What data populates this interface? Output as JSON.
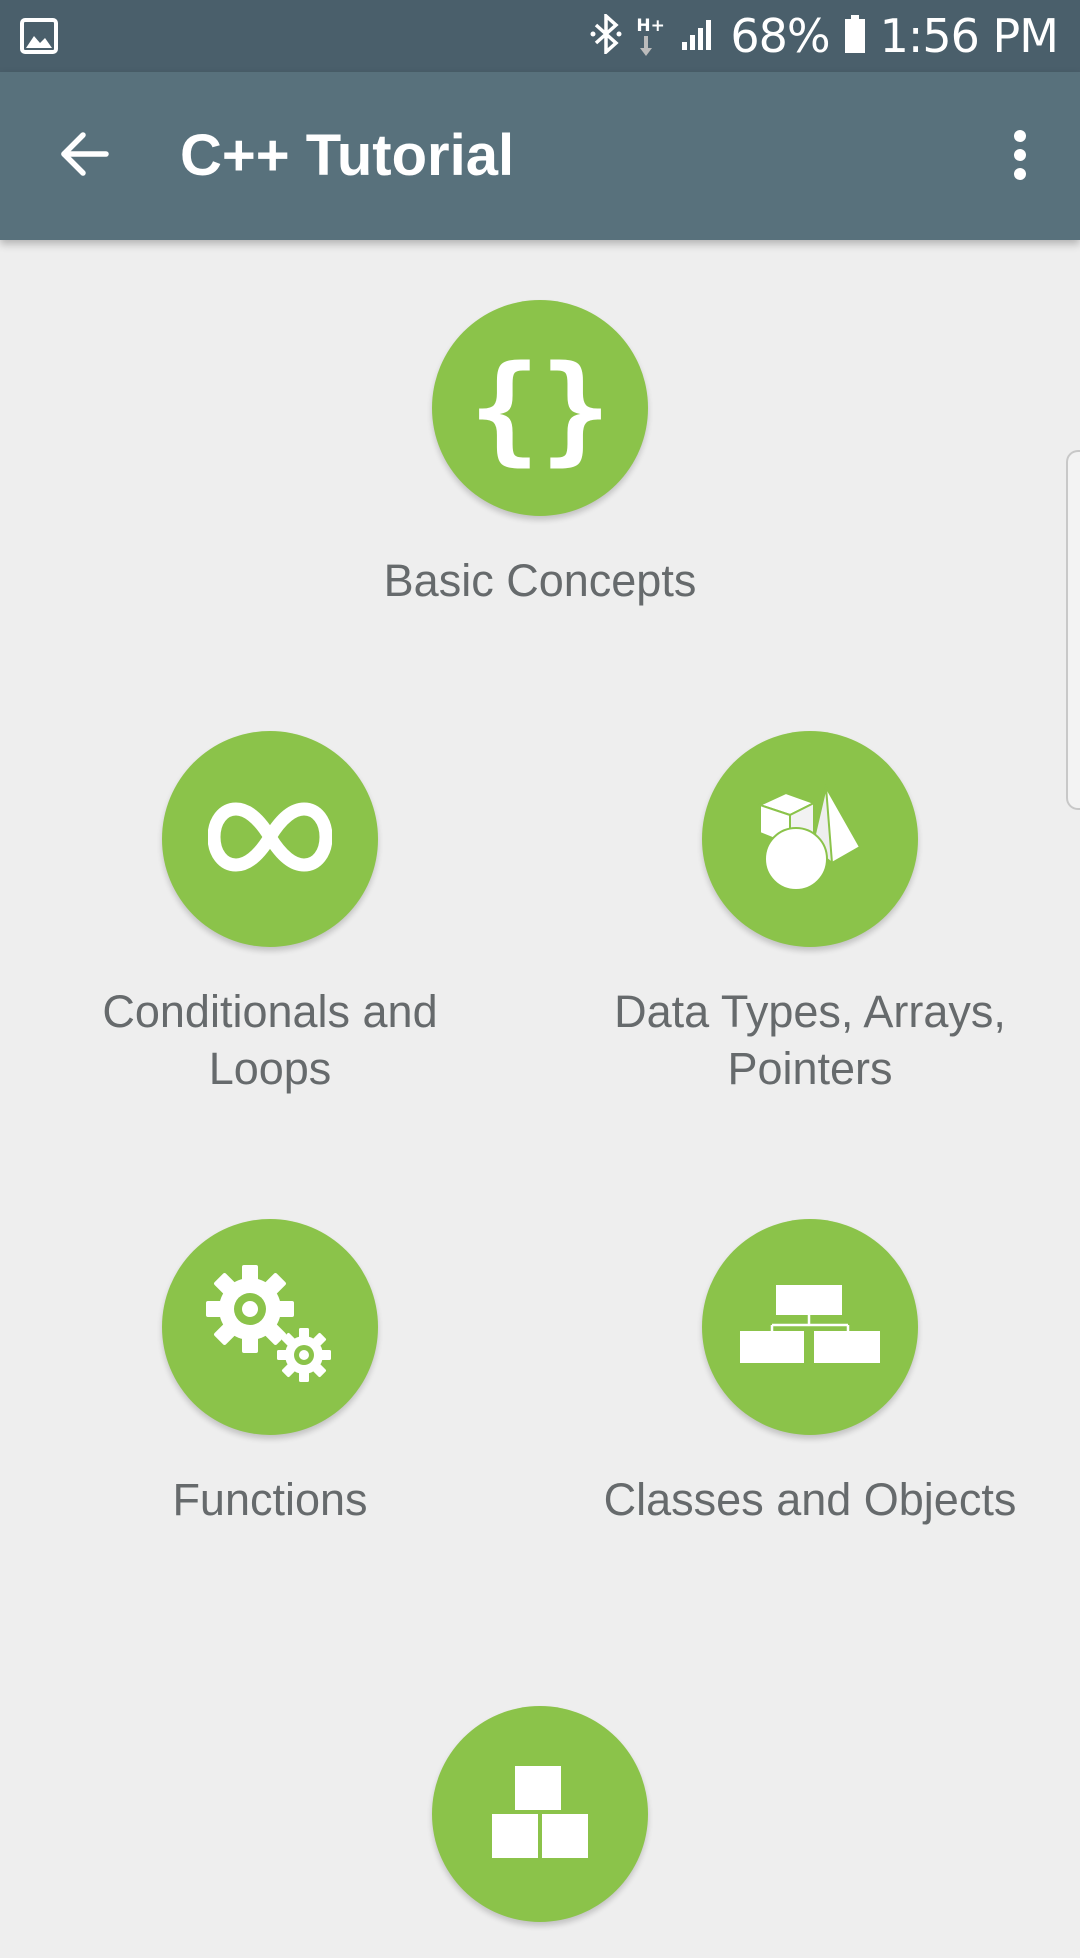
{
  "status_bar": {
    "battery": "68%",
    "time": "1:56 PM",
    "network": "H+"
  },
  "app_bar": {
    "title": "C++ Tutorial",
    "back_icon": "arrow-left-icon",
    "menu_icon": "more-vertical-icon"
  },
  "colors": {
    "accent": "#8bc34a",
    "status_bar": "#4a5f6b",
    "app_bar": "#58717c",
    "background": "#eeeeee",
    "label_text": "#666a6c"
  },
  "topics": [
    {
      "label": "Basic Concepts",
      "icon": "curly-braces-icon"
    },
    {
      "label": "Conditionals and Loops",
      "icon": "infinity-icon"
    },
    {
      "label": "Data Types, Arrays, Pointers",
      "icon": "shapes-icon"
    },
    {
      "label": "Functions",
      "icon": "gears-icon"
    },
    {
      "label": "Classes and Objects",
      "icon": "hierarchy-icon"
    },
    {
      "label": "",
      "icon": "blocks-icon"
    }
  ]
}
